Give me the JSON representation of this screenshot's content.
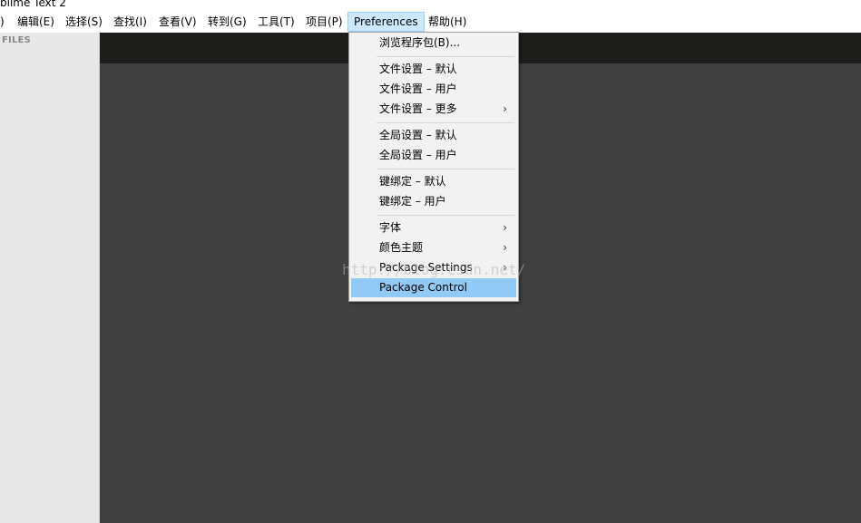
{
  "window": {
    "title": "blime Text 2"
  },
  "menubar": {
    "items": [
      {
        "label": ")"
      },
      {
        "label": "编辑(E)"
      },
      {
        "label": "选择(S)"
      },
      {
        "label": "查找(I)"
      },
      {
        "label": "查看(V)"
      },
      {
        "label": "转到(G)"
      },
      {
        "label": "工具(T)"
      },
      {
        "label": "项目(P)"
      },
      {
        "label": "Preferences"
      },
      {
        "label": "帮助(H)"
      }
    ]
  },
  "sidebar": {
    "label": "FILES"
  },
  "dropdown": {
    "items": [
      {
        "label": "浏览程序包(B)...",
        "submenu": false
      },
      {
        "label": "文件设置 – 默认",
        "submenu": false
      },
      {
        "label": "文件设置 – 用户",
        "submenu": false
      },
      {
        "label": "文件设置 – 更多",
        "submenu": true
      },
      {
        "label": "全局设置 – 默认",
        "submenu": false
      },
      {
        "label": "全局设置 – 用户",
        "submenu": false
      },
      {
        "label": "键绑定 – 默认",
        "submenu": false
      },
      {
        "label": "键绑定 – 用户",
        "submenu": false
      },
      {
        "label": "字体",
        "submenu": true
      },
      {
        "label": "颜色主题",
        "submenu": true
      },
      {
        "label": "Package Settings",
        "submenu": true
      },
      {
        "label": "Package Control",
        "submenu": false,
        "highlighted": true
      }
    ],
    "submenu_arrow": "›"
  },
  "watermark": "http://blog.csdn.net/",
  "colors": {
    "editor_bg": "#404040",
    "tabbar_bg": "#1d1d1b",
    "sidebar_bg": "#e8e8e8",
    "highlight": "#91c9f7",
    "menu_active": "#cce8ff"
  }
}
